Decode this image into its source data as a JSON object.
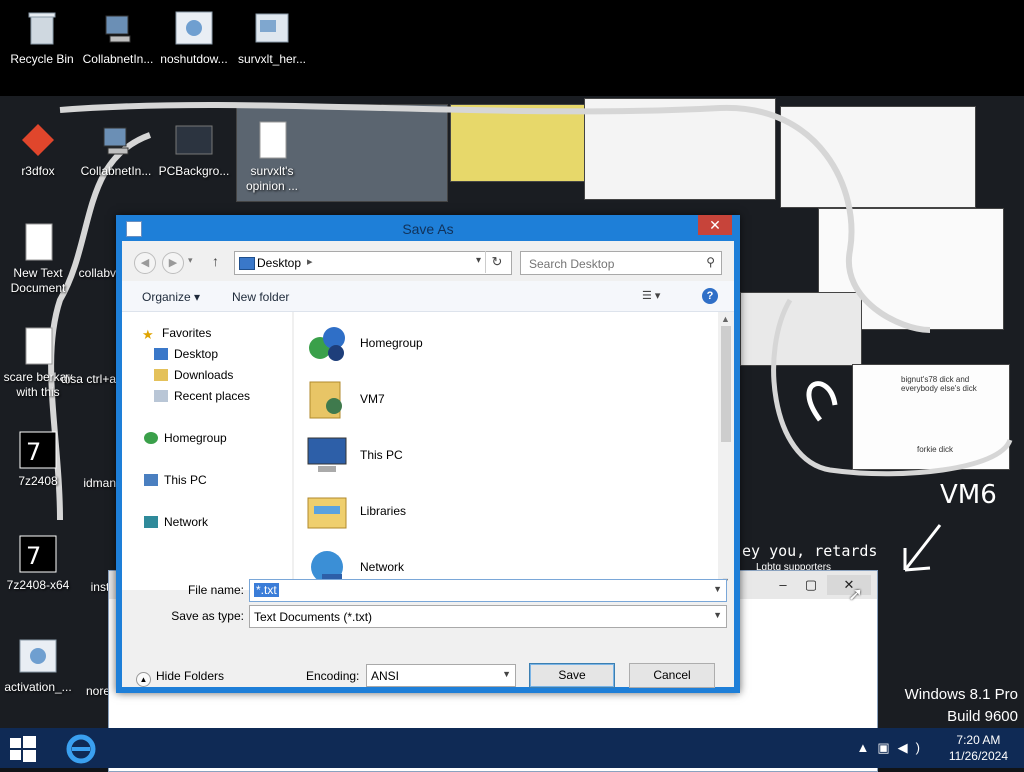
{
  "desktop": {
    "top_icons": [
      "Recycle Bin",
      "CollabnetIn...",
      "noshutdow...",
      "survxlt_her..."
    ],
    "left_icons": [
      "r3dfox",
      "New Text Document",
      "scare berkay with this",
      "7z2408",
      "7z2408-x64",
      "activation_..."
    ],
    "second_col_icons": [
      "CollabnetIn...",
      "collabv",
      "disa ctrl+a",
      "idman",
      "insta",
      "nore"
    ],
    "collage_icons": [
      "PCBackgro...",
      "survxlt's opinion ..."
    ],
    "collage_text": {
      "banner": "ey you, retards",
      "banner_sub": "Lgbtq supporters",
      "vm_label": "VM6",
      "sign_a": "bignut's78 dick and everybody else's dick",
      "sign_b": "forkie dick"
    }
  },
  "dialog": {
    "title": "Save As",
    "address": {
      "location": "Desktop"
    },
    "search_placeholder": "Search Desktop",
    "toolbar": {
      "organize": "Organize ▾",
      "new_folder": "New folder"
    },
    "nav_pane": {
      "favorites": "Favorites",
      "favorites_items": [
        "Desktop",
        "Downloads",
        "Recent places"
      ],
      "homegroup": "Homegroup",
      "this_pc": "This PC",
      "network": "Network"
    },
    "files": [
      "Homegroup",
      "VM7",
      "This PC",
      "Libraries",
      "Network"
    ],
    "file_name_label": "File name:",
    "file_name_value": "*.txt",
    "save_type_label": "Save as type:",
    "save_type_value": "Text Documents (*.txt)",
    "hide_folders": "Hide Folders",
    "encoding_label": "Encoding:",
    "encoding_value": "ANSI",
    "save_button": "Save",
    "cancel_button": "Cancel"
  },
  "system": {
    "watermark_line1": "Windows 8.1 Pro",
    "watermark_line2": "Build 9600",
    "time": "7:20 AM",
    "date": "11/26/2024"
  },
  "colors": {
    "dialog_frame": "#1e7fd8",
    "close_red": "#c7443a",
    "taskbar": "#0f2a55",
    "selection": "#3b7dd8"
  }
}
